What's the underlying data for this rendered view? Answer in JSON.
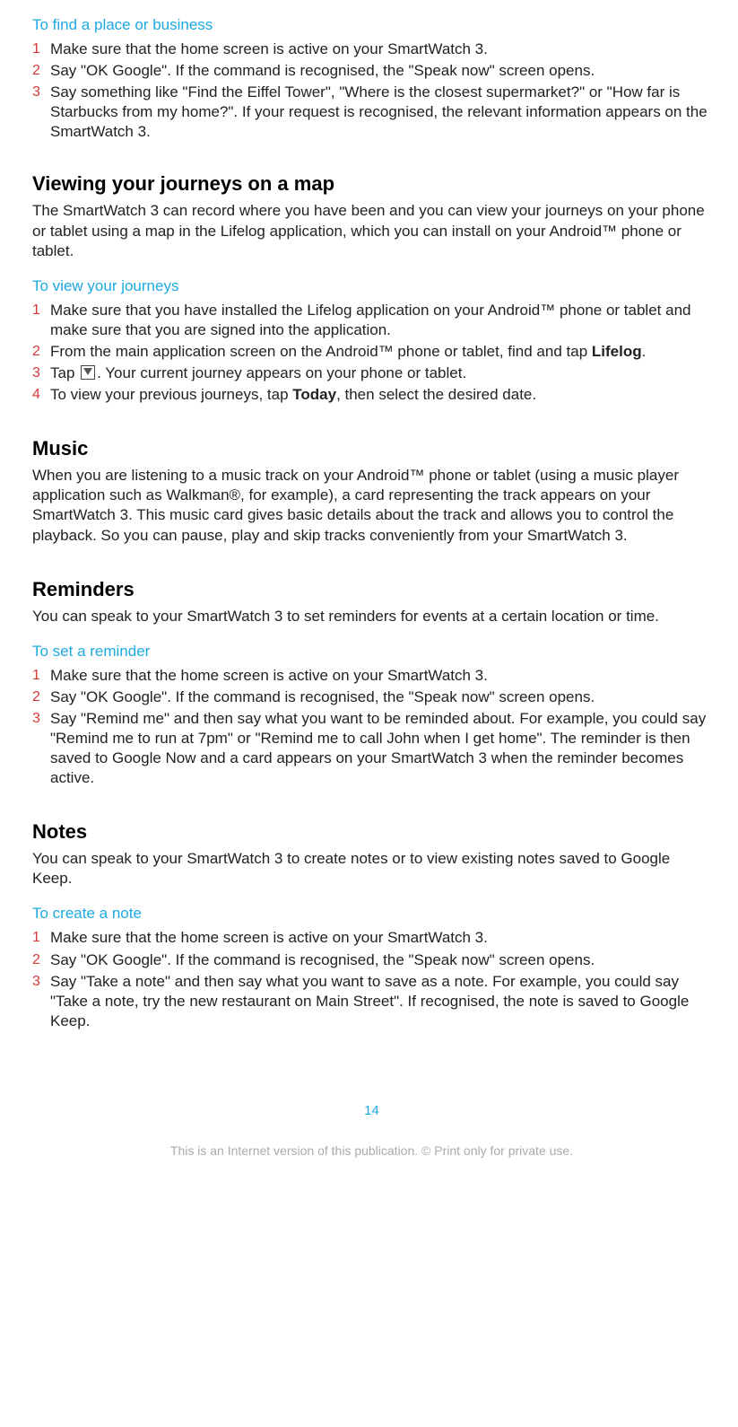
{
  "section_find": {
    "title": "To find a place or business",
    "steps": [
      "Make sure that the home screen is active on your SmartWatch 3.",
      "Say \"OK Google\". If the command is recognised, the \"Speak now\" screen opens.",
      "Say something like \"Find the Eiffel Tower\", \"Where is the closest supermarket?\" or \"How far is Starbucks from my home?\". If your request is recognised, the relevant information appears on the SmartWatch 3."
    ]
  },
  "section_map": {
    "heading": "Viewing your journeys on a map",
    "para": "The SmartWatch 3 can record where you have been and you can view your journeys on your phone or tablet using a map in the Lifelog application, which you can install on your Android™ phone or tablet.",
    "sub": "To view your journeys",
    "step1": "Make sure that you have installed the Lifelog application on your Android™ phone or tablet and make sure that you are signed into the application.",
    "step2a": "From the main application screen on the Android™ phone or tablet, find and tap ",
    "step2b": "Lifelog",
    "step2c": ".",
    "step3a": "Tap ",
    "step3b": ". Your current journey appears on your phone or tablet.",
    "step4a": "To view your previous journeys, tap ",
    "step4b": "Today",
    "step4c": ", then select the desired date."
  },
  "section_music": {
    "heading": "Music",
    "para": "When you are listening to a music track on your Android™ phone or tablet (using a music player application such as Walkman®, for example), a card representing the track appears on your SmartWatch 3. This music card gives basic details about the track and allows you to control the playback. So you can pause, play and skip tracks conveniently from your SmartWatch 3."
  },
  "section_reminders": {
    "heading": "Reminders",
    "para": "You can speak to your SmartWatch 3 to set reminders for events at a certain location or time.",
    "sub": "To set a reminder",
    "steps": [
      "Make sure that the home screen is active on your SmartWatch 3.",
      "Say \"OK Google\". If the command is recognised, the \"Speak now\" screen opens.",
      "Say \"Remind me\" and then say what you want to be reminded about. For example, you could say \"Remind me to run at 7pm\" or \"Remind me to call John when I get home\". The reminder is then saved to Google Now and a card appears on your SmartWatch 3 when the reminder becomes active."
    ]
  },
  "section_notes": {
    "heading": "Notes",
    "para": "You can speak to your SmartWatch 3 to create notes or to view existing notes saved to Google Keep.",
    "sub": "To create a note",
    "steps": [
      "Make sure that the home screen is active on your SmartWatch 3.",
      "Say \"OK Google\". If the command is recognised, the \"Speak now\" screen opens.",
      "Say \"Take a note\" and then say what you want to save as a note. For example, you could say \"Take a note, try the new restaurant on Main Street\". If recognised, the note is saved to Google Keep."
    ]
  },
  "footer": {
    "page_number": "14",
    "disclaimer": "This is an Internet version of this publication. © Print only for private use."
  }
}
